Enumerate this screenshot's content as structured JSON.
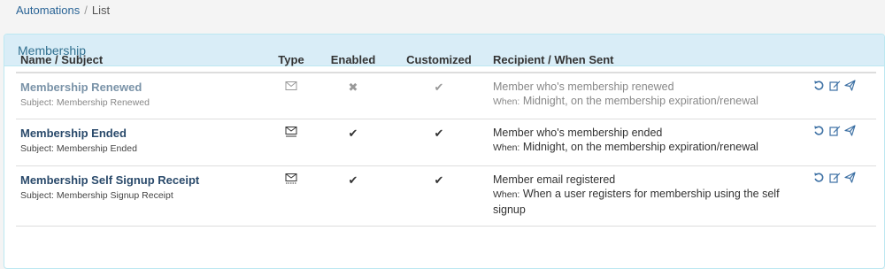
{
  "breadcrumb": {
    "parent": "Automations",
    "separator": "/",
    "current": "List"
  },
  "panel": {
    "title": "Membership"
  },
  "table": {
    "headers": {
      "name": "Name / Subject",
      "type": "Type",
      "enabled": "Enabled",
      "customized": "Customized",
      "recipient": "Recipient / When Sent"
    },
    "rows": [
      {
        "name": "Membership Renewed",
        "subject": "Subject: Membership Renewed",
        "type_icon": "envelope-icon",
        "enabled_mark": "✖",
        "customized_mark": "✔",
        "recipient": "Member who's membership renewed",
        "when_label": "When:",
        "when_text": "Midnight, on the membership expiration/renewal",
        "disabled": true
      },
      {
        "name": "Membership Ended",
        "subject": "Subject: Membership Ended",
        "type_icon": "envelope-icon",
        "enabled_mark": "✔",
        "customized_mark": "✔",
        "recipient": "Member who's membership ended",
        "when_label": "When:",
        "when_text": "Midnight, on the membership expiration/renewal",
        "disabled": false
      },
      {
        "name": "Membership Self Signup Receipt",
        "subject": "Subject: Membership Signup Receipt",
        "type_icon": "envelope-icon",
        "enabled_mark": "✔",
        "customized_mark": "✔",
        "recipient": "Member email registered",
        "when_label": "When:",
        "when_text": "When a user registers for membership using the self signup",
        "disabled": false
      }
    ]
  },
  "colors": {
    "panel_heading_bg": "#d9edf7",
    "panel_border": "#bce8f1",
    "panel_title": "#31708f",
    "link": "#2a6496",
    "action_icon": "#3b6fa3"
  }
}
